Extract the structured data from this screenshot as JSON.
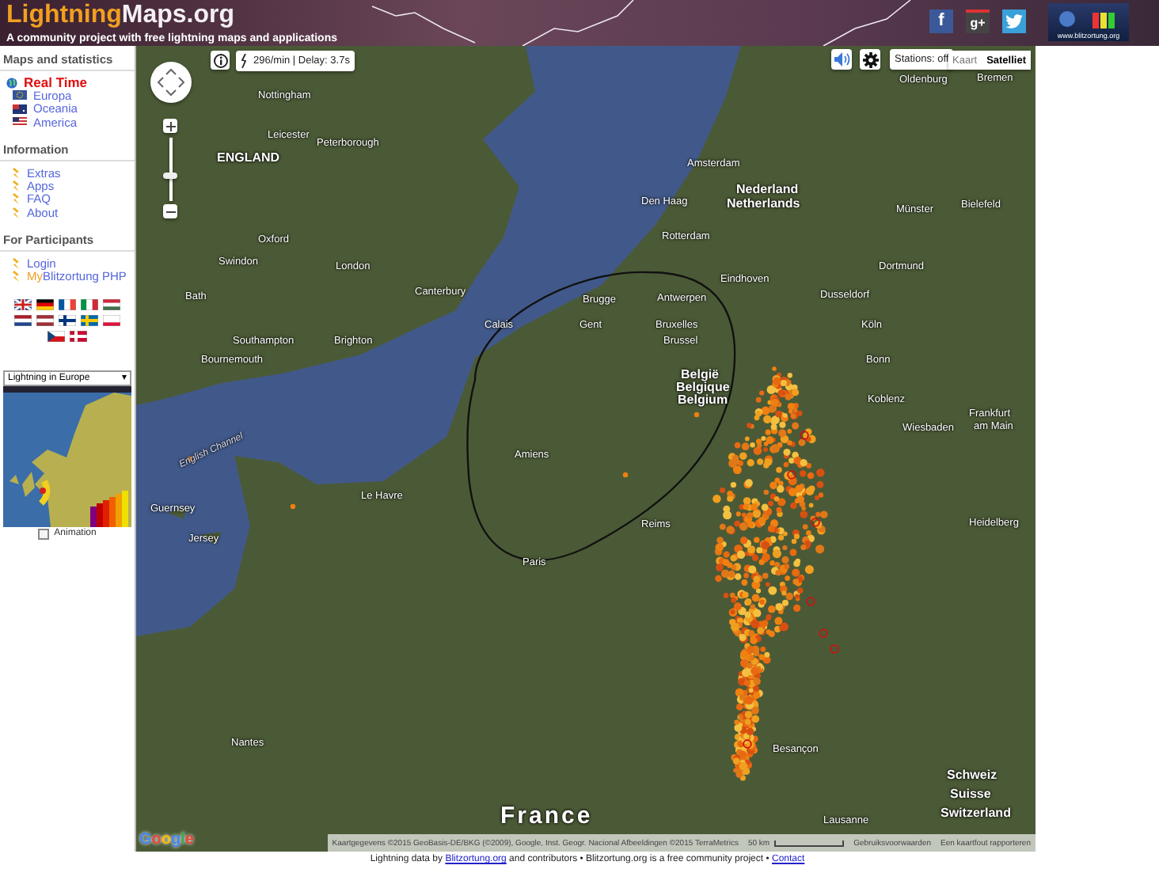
{
  "header": {
    "logo_accent": "Lightning",
    "logo_rest": "Maps.org",
    "tagline": "A community project with free lightning maps and applications",
    "social": [
      {
        "kind": "facebook",
        "glyph": "f"
      },
      {
        "kind": "googleplus",
        "glyph": "g+"
      },
      {
        "kind": "twitter"
      }
    ],
    "badge_text": "www.blitzortung.org"
  },
  "sidebar": {
    "sections": [
      {
        "heading": "Maps and statistics",
        "items": [
          {
            "kind": "globe",
            "label": "Real Time",
            "selected": true
          },
          {
            "kind": "flag-eu",
            "label": "Europa",
            "selected": false
          },
          {
            "kind": "flag-au",
            "label": "Oceania",
            "selected": false
          },
          {
            "kind": "flag-us",
            "label": "America",
            "selected": false
          }
        ]
      },
      {
        "heading": "Information",
        "items": [
          {
            "kind": "bolt",
            "label": "Extras",
            "selected": false
          },
          {
            "kind": "bolt",
            "label": "Apps",
            "selected": false
          },
          {
            "kind": "bolt",
            "label": "FAQ",
            "selected": false
          },
          {
            "kind": "bolt",
            "label": "About",
            "selected": false
          }
        ]
      },
      {
        "heading": "For Participants",
        "items": [
          {
            "kind": "bolt",
            "label": "Login",
            "selected": false
          },
          {
            "kind": "bolt",
            "prefix": "My",
            "label": "Blitzortung PHP",
            "selected": false
          }
        ]
      }
    ],
    "languages": [
      {
        "kind": "gb"
      },
      {
        "kind": "de"
      },
      {
        "kind": "fr"
      },
      {
        "kind": "it"
      },
      {
        "kind": "hu"
      },
      {
        "kind": "nl"
      },
      {
        "kind": "lv"
      },
      {
        "kind": "fi"
      },
      {
        "kind": "se"
      },
      {
        "kind": "pl"
      },
      {
        "kind": "cz"
      },
      {
        "kind": "dk"
      }
    ],
    "mini_map": {
      "dropdown": "Lightning in Europe",
      "dropdown_caret": "▾",
      "animation_label": "Animation",
      "animation_checked": false
    }
  },
  "map": {
    "rate": "296/min | Delay: 3.7s",
    "stations": "Stations: off",
    "map_types": [
      {
        "label": "Kaart",
        "selected": false
      },
      {
        "label": "Satelliet",
        "selected": true
      }
    ],
    "labels": [
      {
        "kind": "city",
        "text": "Oldenburg"
      },
      {
        "kind": "city",
        "text": "Bremen"
      },
      {
        "kind": "city",
        "text": "Nottingham"
      },
      {
        "kind": "city",
        "text": "Leicester"
      },
      {
        "kind": "city",
        "text": "Peterborough"
      },
      {
        "kind": "country",
        "text": "ENGLAND"
      },
      {
        "kind": "city",
        "text": "Amsterdam"
      },
      {
        "kind": "country",
        "text": "Nederland"
      },
      {
        "kind": "city",
        "text": "Den Haag"
      },
      {
        "kind": "country",
        "text": "Netherlands"
      },
      {
        "kind": "city",
        "text": "Münster"
      },
      {
        "kind": "city",
        "text": "Bielefeld"
      },
      {
        "kind": "city",
        "text": "Oxford"
      },
      {
        "kind": "city",
        "text": "Rotterdam"
      },
      {
        "kind": "city",
        "text": "Swindon"
      },
      {
        "kind": "city",
        "text": "London"
      },
      {
        "kind": "city",
        "text": "Dortmund"
      },
      {
        "kind": "city",
        "text": "Eindhoven"
      },
      {
        "kind": "city",
        "text": "Bath"
      },
      {
        "kind": "city",
        "text": "Canterbury"
      },
      {
        "kind": "city",
        "text": "Brugge"
      },
      {
        "kind": "city",
        "text": "Antwerpen"
      },
      {
        "kind": "city",
        "text": "Dusseldorf"
      },
      {
        "kind": "city",
        "text": "Calais"
      },
      {
        "kind": "city",
        "text": "Gent"
      },
      {
        "kind": "city",
        "text": "Bruxelles"
      },
      {
        "kind": "city",
        "text": "Köln"
      },
      {
        "kind": "city",
        "text": "Southampton"
      },
      {
        "kind": "city",
        "text": "Brighton"
      },
      {
        "kind": "city",
        "text": "Brussel"
      },
      {
        "kind": "city",
        "text": "Bournemouth"
      },
      {
        "kind": "city",
        "text": "Bonn"
      },
      {
        "kind": "country",
        "text": "België"
      },
      {
        "kind": "country",
        "text": "Belgique"
      },
      {
        "kind": "country",
        "text": "Belgium"
      },
      {
        "kind": "city",
        "text": "Koblenz"
      },
      {
        "kind": "city",
        "text": "Frankfurt"
      },
      {
        "kind": "city",
        "text": "Wiesbaden"
      },
      {
        "kind": "city",
        "text": "am Main"
      },
      {
        "kind": "water",
        "text": "English Channel"
      },
      {
        "kind": "city",
        "text": "Amiens"
      },
      {
        "kind": "city",
        "text": "Le Havre"
      },
      {
        "kind": "city",
        "text": "Guernsey"
      },
      {
        "kind": "city",
        "text": "Reims"
      },
      {
        "kind": "city",
        "text": "Heidelberg"
      },
      {
        "kind": "city",
        "text": "Jersey"
      },
      {
        "kind": "city",
        "text": "Paris"
      },
      {
        "kind": "city",
        "text": "Nantes"
      },
      {
        "kind": "city",
        "text": "Besançon"
      },
      {
        "kind": "country",
        "text": "Schweiz"
      },
      {
        "kind": "country",
        "text": "Suisse"
      },
      {
        "kind": "big-country",
        "text": "France"
      },
      {
        "kind": "city",
        "text": "Lausanne"
      },
      {
        "kind": "country",
        "text": "Switzerland"
      }
    ],
    "google_logo": "Google",
    "attribution": "Kaartgegevens ©2015 GeoBasis-DE/BKG (©2009), Google, Inst. Geogr. Nacional Afbeeldingen ©2015 TerraMetrics",
    "scale": "50 km",
    "terms": "Gebruiksvoorwaarden",
    "report": "Een kaartfout rapporteren"
  },
  "footer": {
    "text_before": "Lightning data by",
    "link": "Blitzortung.org",
    "text_middle": "and contributors • Blitzortung.org is a free community project •",
    "contact_link": "Contact"
  }
}
